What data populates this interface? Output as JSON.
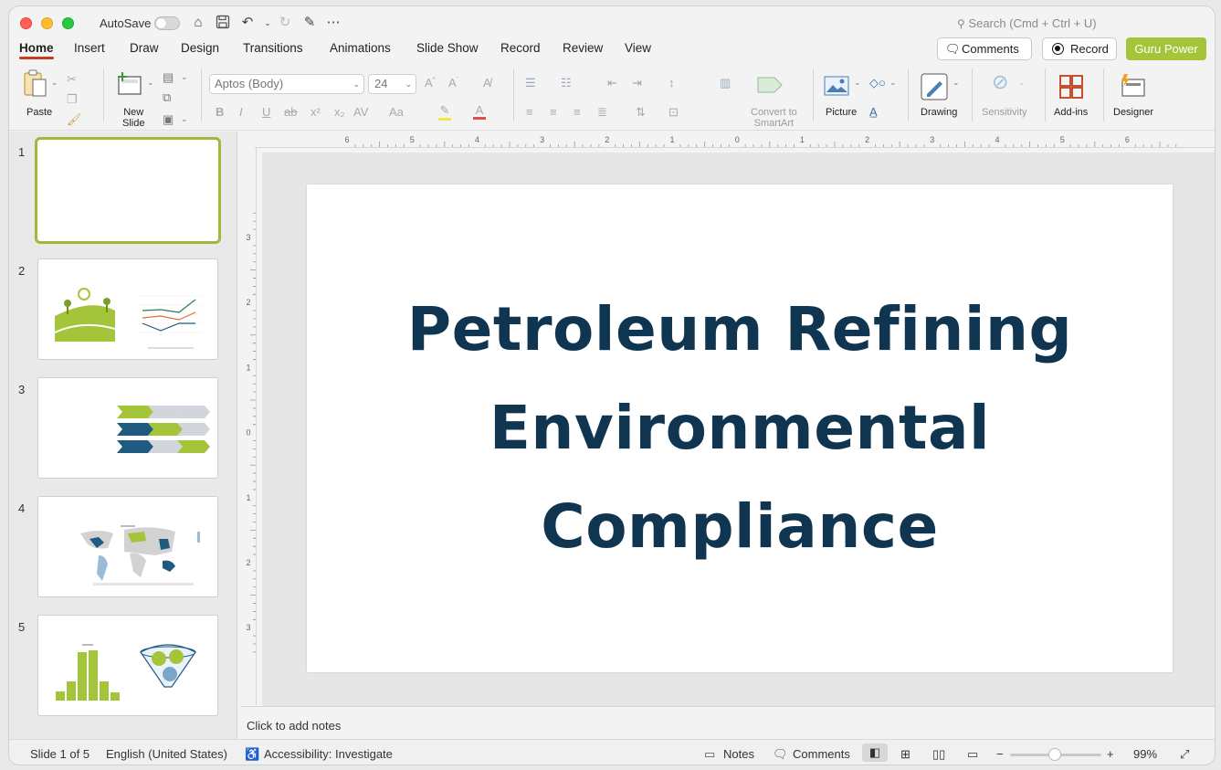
{
  "titlebar": {
    "autosave_label": "AutoSave",
    "search_placeholder": "Search (Cmd + Ctrl + U)"
  },
  "tabs": [
    {
      "label": "Home",
      "active": true
    },
    {
      "label": "Insert"
    },
    {
      "label": "Draw"
    },
    {
      "label": "Design"
    },
    {
      "label": "Transitions"
    },
    {
      "label": "Animations"
    },
    {
      "label": "Slide Show"
    },
    {
      "label": "Record"
    },
    {
      "label": "Review"
    },
    {
      "label": "View"
    }
  ],
  "header_buttons": {
    "comments": "Comments",
    "record": "Record",
    "guru": "Guru Power"
  },
  "ribbon": {
    "paste": "Paste",
    "new_slide_line1": "New",
    "new_slide_line2": "Slide",
    "font_name": "Aptos (Body)",
    "font_size": "24",
    "convert_line1": "Convert to",
    "convert_line2": "SmartArt",
    "picture": "Picture",
    "drawing": "Drawing",
    "sensitivity": "Sensitivity",
    "addins": "Add-ins",
    "designer": "Designer"
  },
  "thumbnails": [
    {
      "number": "1",
      "selected": true
    },
    {
      "number": "2"
    },
    {
      "number": "3"
    },
    {
      "number": "4"
    },
    {
      "number": "5"
    }
  ],
  "slide": {
    "title_line1": "Petroleum Refining",
    "title_line2": "Environmental",
    "title_line3": "Compliance"
  },
  "ruler": {
    "h_labels": [
      "6",
      "5",
      "4",
      "3",
      "2",
      "1",
      "0",
      "1",
      "2",
      "3",
      "4",
      "5",
      "6"
    ],
    "v_labels": [
      "3",
      "2",
      "1",
      "0",
      "1",
      "2",
      "3"
    ]
  },
  "notes_placeholder": "Click to add notes",
  "statusbar": {
    "slide_info": "Slide 1 of 5",
    "language": "English (United States)",
    "accessibility": "Accessibility: Investigate",
    "notes": "Notes",
    "comments": "Comments",
    "zoom": "99%"
  },
  "colors": {
    "accent": "#c43e1c",
    "guru": "#a4c43a",
    "title": "#0f3550",
    "lime": "#a4c43a",
    "navy": "#1f5a80"
  }
}
